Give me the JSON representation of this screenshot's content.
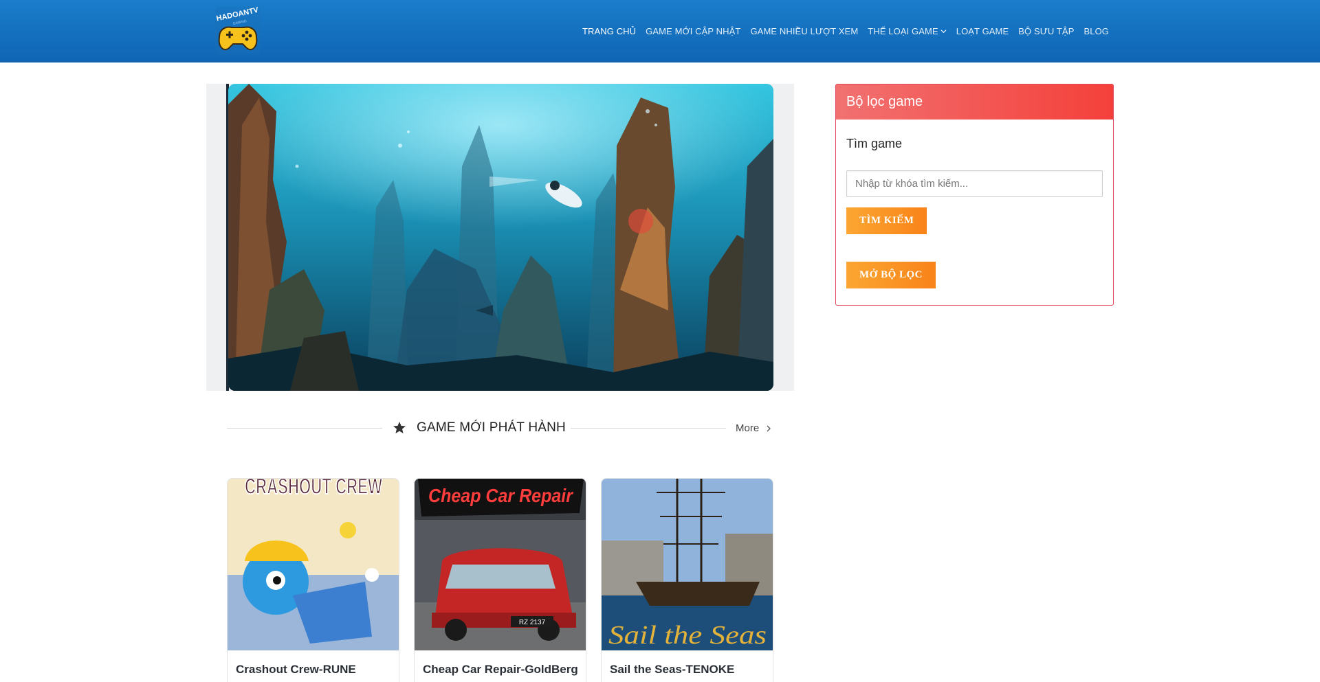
{
  "header": {
    "logo_text": "HADOANTV",
    "logo_subtext": "GAMING",
    "nav": [
      {
        "label": "TRANG CHỦ",
        "active": true
      },
      {
        "label": "GAME MỚI CẬP NHẬT",
        "active": false
      },
      {
        "label": "GAME NHIỀU LƯỢT XEM",
        "active": false
      },
      {
        "label": "THỂ LOẠI GAME",
        "active": false,
        "has_dropdown": true
      },
      {
        "label": "LOẠT GAME",
        "active": false
      },
      {
        "label": "BỘ SƯU TẬP",
        "active": false
      },
      {
        "label": "BLOG",
        "active": false
      }
    ]
  },
  "slider": {
    "slide_count": 10,
    "active_index": 1
  },
  "section": {
    "title": "GAME MỚI PHÁT HÀNH",
    "more_label": "More",
    "icon": "star-icon"
  },
  "games": [
    {
      "title": "Crashout Crew-RUNE",
      "art_text": "CRASHOUT CREW"
    },
    {
      "title": "Cheap Car Repair-GoldBerg",
      "art_text": "Cheap Car Repair",
      "plate": "RZ 2137"
    },
    {
      "title": "Sail the Seas-TENOKE",
      "art_text": "Sail the Seas"
    }
  ],
  "filter": {
    "header": "Bộ lọc game",
    "label": "Tìm game",
    "search_placeholder": "Nhập từ khóa tìm kiếm...",
    "search_button": "TÌM KIẾM",
    "open_filter_button": "MỞ BỘ LỌC"
  },
  "colors": {
    "header_bg": "#1272c0",
    "filter_accent": "#f4403a",
    "button_orange": "#f98319"
  }
}
